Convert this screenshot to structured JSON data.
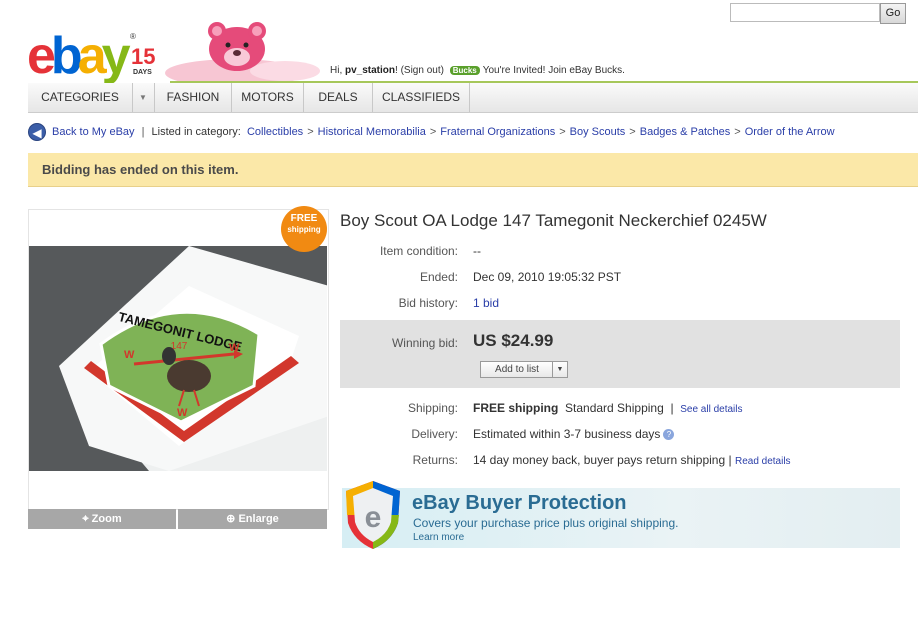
{
  "search": {
    "placeholder": "",
    "go_label": "Go"
  },
  "header": {
    "logo": {
      "e": "e",
      "b": "b",
      "a": "a",
      "y": "y",
      "anniversary": "15",
      "days": "DAYS",
      "reg": "®"
    },
    "greeting_prefix": "Hi, ",
    "username": "pv_station",
    "greeting_suffix": "!",
    "sign_out": "(Sign out)",
    "bucks_badge": "Bucks",
    "bucks_message": "You're Invited! Join eBay Bucks."
  },
  "nav": {
    "items": [
      {
        "label": "CATEGORIES"
      },
      {
        "label": "FASHION"
      },
      {
        "label": "MOTORS"
      },
      {
        "label": "DEALS"
      },
      {
        "label": "CLASSIFIEDS"
      }
    ]
  },
  "breadcrumb": {
    "back_label": "Back to My eBay",
    "listed_in": "Listed in category:",
    "categories": [
      "Collectibles",
      "Historical Memorabilia",
      "Fraternal Organizations",
      "Boy Scouts",
      "Badges & Patches",
      "Order of the Arrow"
    ]
  },
  "banner": {
    "message": "Bidding has ended on this item."
  },
  "image_panel": {
    "free_shipping_line1": "FREE",
    "free_shipping_line2": "shipping",
    "zoom_label": "Zoom",
    "enlarge_label": "Enlarge",
    "patch_text": "TAMEGONIT LODGE",
    "patch_number": "147"
  },
  "item": {
    "title": "Boy Scout OA Lodge 147 Tamegonit Neckerchief 0245W",
    "condition_label": "Item condition:",
    "condition_value": "--",
    "ended_label": "Ended:",
    "ended_value": "Dec 09, 2010 19:05:32 PST",
    "bid_history_label": "Bid history:",
    "bid_history_value": "1 bid",
    "winning_bid_label": "Winning bid:",
    "winning_bid_value": "US $24.99",
    "add_to_list": "Add to list",
    "shipping_label": "Shipping:",
    "shipping_free": "FREE shipping",
    "shipping_type": "Standard Shipping",
    "shipping_sep": "|",
    "shipping_link": "See all details",
    "delivery_label": "Delivery:",
    "delivery_value": "Estimated within 3-7 business days",
    "returns_label": "Returns:",
    "returns_value": "14 day money back, buyer pays return shipping",
    "returns_sep": "|",
    "returns_link": "Read details"
  },
  "protection": {
    "title": "eBay Buyer Protection",
    "subtitle": "Covers your purchase price plus original shipping.",
    "learn_more": "Learn more"
  }
}
